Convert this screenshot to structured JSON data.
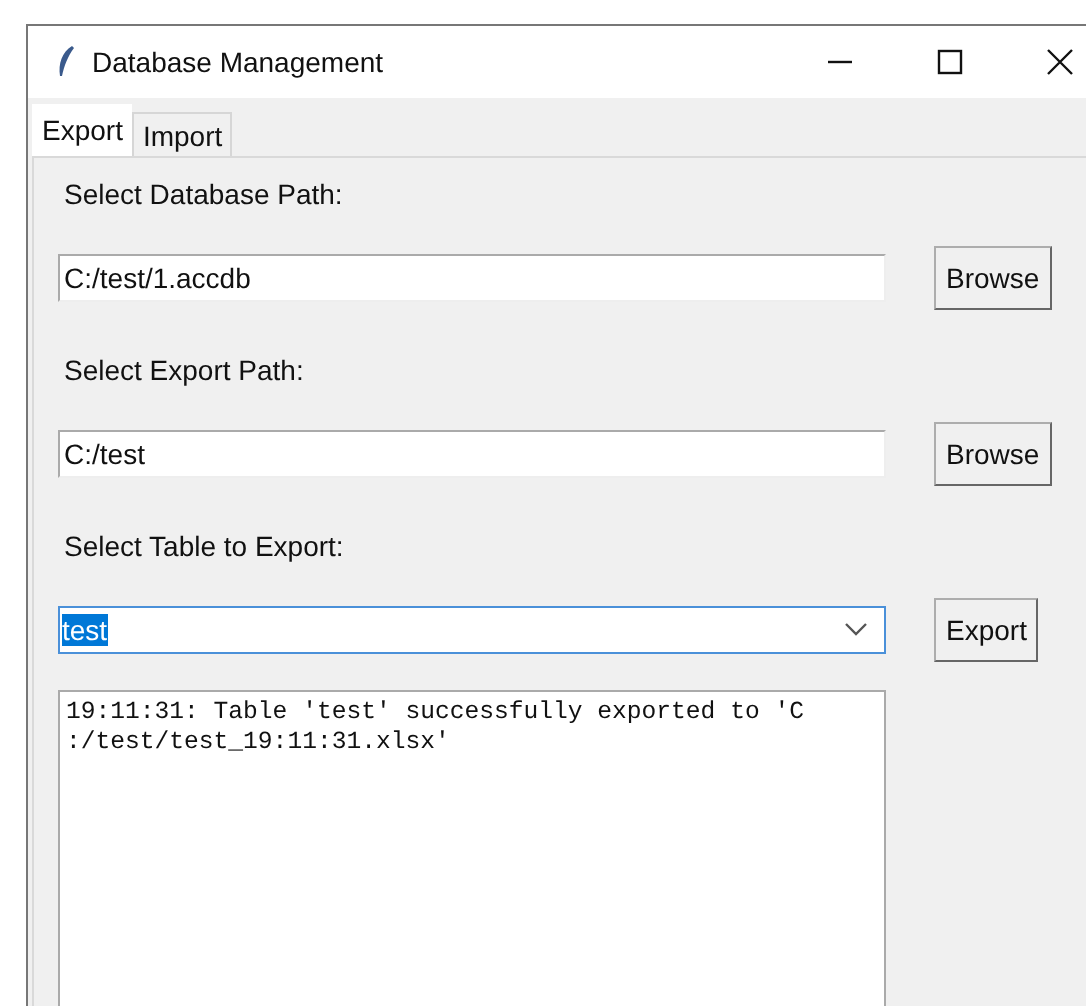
{
  "window": {
    "title": "Database Management"
  },
  "tabs": [
    {
      "label": "Export",
      "selected": true
    },
    {
      "label": "Import",
      "selected": false
    }
  ],
  "rows": [
    {
      "label": "Select Database Path:",
      "kind": "entry",
      "value": "C:/test/1.accdb",
      "button": "Browse"
    },
    {
      "label": "Select Export Path:",
      "kind": "entry",
      "value": "C:/test",
      "button": "Browse"
    },
    {
      "label": "Select Table to Export:",
      "kind": "combo",
      "value": "test",
      "text_selected": true,
      "button": "Export"
    }
  ],
  "log": {
    "lines": [
      "19:11:31: Table 'test' successfully exported to 'C",
      ":/test/test_19:11:31.xlsx'"
    ]
  }
}
